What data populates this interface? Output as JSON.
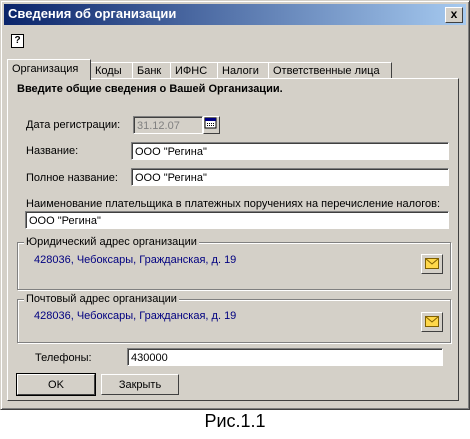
{
  "window": {
    "title": "Сведения об организации",
    "close_symbol": "x"
  },
  "help_symbol": "?",
  "tabs": [
    {
      "label": "Организация",
      "active": true
    },
    {
      "label": "Коды"
    },
    {
      "label": "Банк"
    },
    {
      "label": "ИФНС"
    },
    {
      "label": "Налоги"
    },
    {
      "label": "Ответственные лица"
    }
  ],
  "form": {
    "heading": "Введите общие сведения о Вашей Организации.",
    "reg_date_label": "Дата регистрации:",
    "reg_date_value": "31.12.07",
    "name_label": "Название:",
    "name_value": "ООО \"Регина\"",
    "full_name_label": "Полное название:",
    "full_name_value": "ООО \"Регина\"",
    "payer_label": "Наименование плательщика в платежных поручениях на перечисление налогов:",
    "payer_value": "ООО \"Регина\"",
    "legal_address_title": "Юридический адрес организации",
    "legal_address_value": "428036, Чебоксары, Гражданская, д. 19",
    "postal_address_title": "Почтовый адрес организации",
    "postal_address_value": "428036, Чебоксары, Гражданская, д. 19",
    "phones_label": "Телефоны:",
    "phones_value": "430000"
  },
  "buttons": {
    "ok": "OK",
    "close": "Закрыть"
  },
  "caption": "Рис.1.1"
}
